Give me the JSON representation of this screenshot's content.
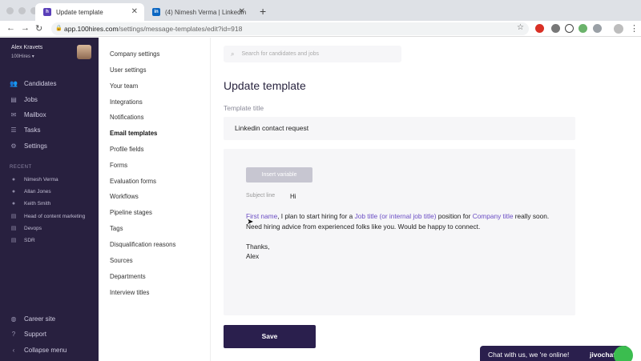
{
  "browser": {
    "tabs": [
      {
        "title": "Update template",
        "active": true,
        "favicon": "100hires-icon"
      },
      {
        "title": "(4) Nimesh Verma | LinkedIn",
        "active": false,
        "favicon": "linkedin-icon"
      }
    ],
    "url_host": "app.100hires.com",
    "url_path": "/settings/message-templates/edit?id=918"
  },
  "sidebar": {
    "user_name": "Alex Kravets",
    "org": "100Hires",
    "nav": [
      {
        "label": "Candidates",
        "icon": "people-icon"
      },
      {
        "label": "Jobs",
        "icon": "document-icon"
      },
      {
        "label": "Mailbox",
        "icon": "mail-icon"
      },
      {
        "label": "Tasks",
        "icon": "list-icon"
      },
      {
        "label": "Settings",
        "icon": "gear-icon"
      }
    ],
    "recent_title": "RECENT",
    "recent": [
      {
        "label": "Nimesh Verma",
        "icon": "person-icon"
      },
      {
        "label": "Allan Jones",
        "icon": "person-icon"
      },
      {
        "label": "Keith Smith",
        "icon": "person-icon"
      },
      {
        "label": "Head of content marketing",
        "icon": "document-icon"
      },
      {
        "label": "Devops",
        "icon": "document-icon"
      },
      {
        "label": "SDR",
        "icon": "document-icon"
      }
    ],
    "footer": [
      {
        "label": "Career site",
        "icon": "globe-icon"
      },
      {
        "label": "Support",
        "icon": "help-icon"
      },
      {
        "label": "Collapse menu",
        "icon": "chevron-left-icon"
      }
    ]
  },
  "settings_menu": [
    "Company settings",
    "User settings",
    "Your team",
    "Integrations",
    "Notifications",
    "Email templates",
    "Profile fields",
    "Forms",
    "Evaluation forms",
    "Workflows",
    "Pipeline stages",
    "Tags",
    "Disqualification reasons",
    "Sources",
    "Departments",
    "Interview titles"
  ],
  "settings_menu_active": "Email templates",
  "main": {
    "search_placeholder": "Search for candidates and jobs",
    "page_title": "Update template",
    "template_title_label": "Template title",
    "template_title_value": "Linkedin contact request",
    "insert_variable": "Insert variable",
    "subject_label": "Subject line",
    "subject_value": "Hi",
    "body": {
      "var_first_name": "First name",
      "text_1": ", I plan to start hiring for a ",
      "var_job_title": "Job title (or internal job title)",
      "text_2": " position for ",
      "var_company": "Company title",
      "text_3": " really soon. Need hiring advice from experienced folks like you. Would be happy to connect.",
      "sign_off": "Thanks,",
      "signature": "Alex"
    },
    "save_label": "Save"
  },
  "chat": {
    "text": "Chat with us, we 're online!",
    "brand": "jivochat"
  },
  "colors": {
    "sidebar_bg": "#28203f",
    "primary": "#2a1f4d",
    "variable": "#6a4cc4"
  }
}
